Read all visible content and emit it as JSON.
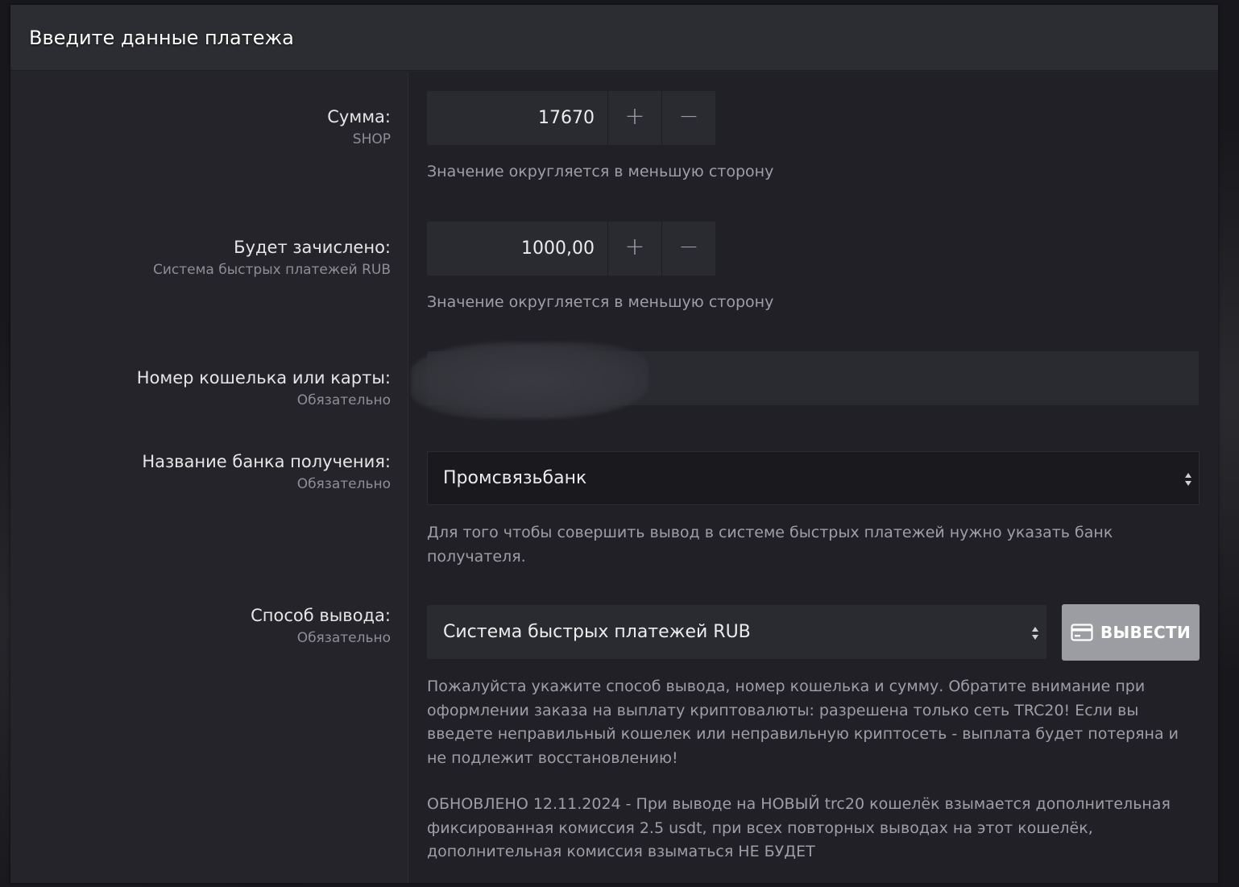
{
  "panel": {
    "title": "Введите данные платежа"
  },
  "fields": {
    "amount": {
      "label": "Сумма:",
      "sublabel": "SHOP",
      "value": "17670",
      "plus": "+",
      "minus": "−",
      "hint": "Значение округляется в меньшую сторону"
    },
    "credited": {
      "label": "Будет зачислено:",
      "sublabel": "Система быстрых платежей RUB",
      "value": "1000,00",
      "plus": "+",
      "minus": "−",
      "hint": "Значение округляется в меньшую сторону"
    },
    "wallet": {
      "label": "Номер кошелька или карты:",
      "sublabel": "Обязательно",
      "value": ""
    },
    "bank": {
      "label": "Название банка получения:",
      "sublabel": "Обязательно",
      "selected": "Промсвязьбанк",
      "hint_line1": "Для того чтобы совершить вывод в системе быстрых платежей нужно указать банк",
      "hint_line2": "получателя."
    },
    "method": {
      "label": "Способ вывода:",
      "sublabel": "Обязательно",
      "selected": "Система быстрых платежей RUB",
      "button_label": "ВЫВЕСТИ",
      "button_icon": "credit-card-icon",
      "notice_lines": [
        "Пожалуйста укажите способ вывода, номер кошелька и сумму. Обратите внимание при",
        "оформлении заказа на выплату криптовалюты: разрешена только сеть TRC20! Если вы",
        "введете неправильный кошелек или неправильную криптосеть - выплата будет потеряна и",
        "не подлежит восстановлению!"
      ],
      "update_lines": [
        "ОБНОВЛЕНО 12.11.2024 - При выводе на НОВЫЙ trc20 кошелёк взымается дополнительная",
        "фиксированная комиссия 2.5 usdt, при всех повторных выводах на этот кошелёк,",
        "дополнительная комиссия взыматься НЕ БУДЕТ"
      ]
    }
  },
  "colors": {
    "panel_bg": "#24242a",
    "header_bg": "#2c2c33",
    "input_bg": "#2a2a31",
    "select_bg": "#19191e",
    "button_bg": "#9c9ca3",
    "hint_text": "#9e9ea6"
  }
}
